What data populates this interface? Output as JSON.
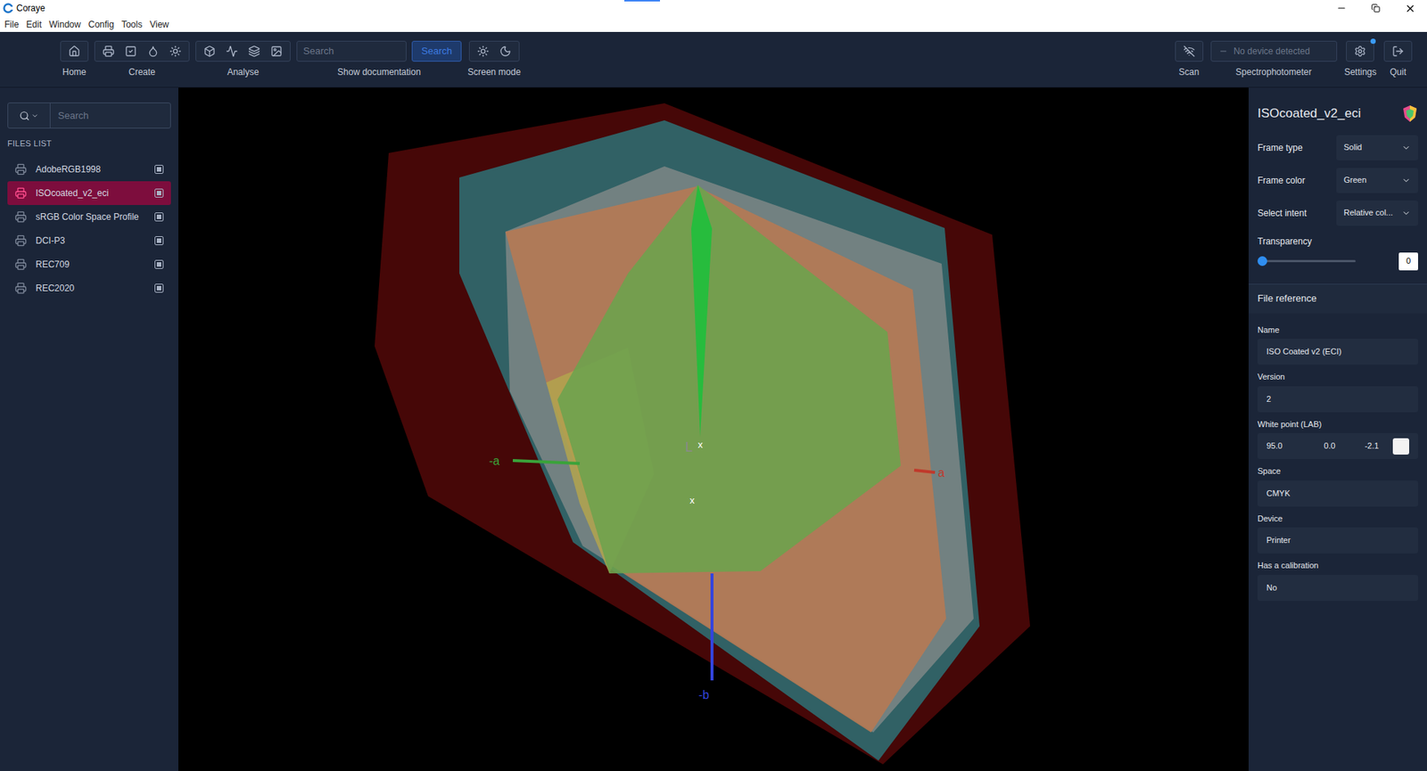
{
  "window": {
    "title": "Coraye"
  },
  "menu": [
    "File",
    "Edit",
    "Window",
    "Config",
    "Tools",
    "View"
  ],
  "toolbar": {
    "home": "Home",
    "create": "Create",
    "analyse": "Analyse",
    "search_placeholder": "Search",
    "search_button": "Search",
    "documentation": "Show documentation",
    "screen_mode": "Screen mode",
    "scan": "Scan",
    "spectrophotometer": {
      "label": "Spectrophotometer",
      "value": "No device detected"
    },
    "settings": "Settings",
    "settings_badge": true,
    "quit": "Quit"
  },
  "sidebar": {
    "search_placeholder": "Search",
    "heading": "FILES LIST",
    "items": [
      {
        "name": "AdobeRGB1998",
        "selected": false,
        "visible": true
      },
      {
        "name": "ISOcoated_v2_eci",
        "selected": true,
        "visible": true
      },
      {
        "name": "sRGB Color Space Profile",
        "selected": false,
        "visible": true
      },
      {
        "name": "DCI-P3",
        "selected": false,
        "visible": true
      },
      {
        "name": "REC709",
        "selected": false,
        "visible": true
      },
      {
        "name": "REC2020",
        "selected": false,
        "visible": true
      }
    ]
  },
  "viewer": {
    "layers": [
      {
        "color": "#4a0707",
        "opacity": 0.95
      },
      {
        "color": "#2f6b70",
        "opacity": 0.9
      },
      {
        "color": "#7a8584",
        "opacity": 0.9
      },
      {
        "color": "#b47a55",
        "opacity": 0.92
      },
      {
        "color": "#b3a44e",
        "opacity": 0.85
      },
      {
        "color": "#6ea24e",
        "opacity": 0.9
      },
      {
        "color": "#1fbf3c",
        "opacity": 0.9
      }
    ],
    "axes": [
      {
        "label": "-a",
        "color": "#3aa33a"
      },
      {
        "label": "a",
        "color": "#c0392b"
      },
      {
        "label": "L",
        "color": "#8a8a8a"
      },
      {
        "label": "x",
        "color": "#ffffff"
      },
      {
        "label": "x",
        "color": "#ffffff"
      },
      {
        "label": "-b",
        "color": "#3344dd"
      }
    ]
  },
  "panel": {
    "title": "ISOcoated_v2_eci",
    "controls": [
      {
        "label": "Frame type",
        "value": "Solid"
      },
      {
        "label": "Frame color",
        "value": "Green"
      },
      {
        "label": "Select intent",
        "value": "Relative col..."
      }
    ],
    "transparency": {
      "label": "Transparency",
      "level": 0,
      "value": "0"
    },
    "section": "File reference",
    "fields": [
      {
        "label": "Name",
        "kind": "text",
        "values": [
          "ISO Coated v2 (ECI)"
        ]
      },
      {
        "label": "Version",
        "kind": "text",
        "values": [
          "2"
        ]
      },
      {
        "label": "White point (LAB)",
        "kind": "lab",
        "values": [
          "95.0",
          "0.0",
          "-2.1"
        ],
        "swatch": "#f2f2f2"
      },
      {
        "label": "Space",
        "kind": "text",
        "values": [
          "CMYK"
        ]
      },
      {
        "label": "Device",
        "kind": "text",
        "values": [
          "Printer"
        ]
      },
      {
        "label": "Has a calibration",
        "kind": "text",
        "values": [
          "No"
        ]
      }
    ]
  }
}
